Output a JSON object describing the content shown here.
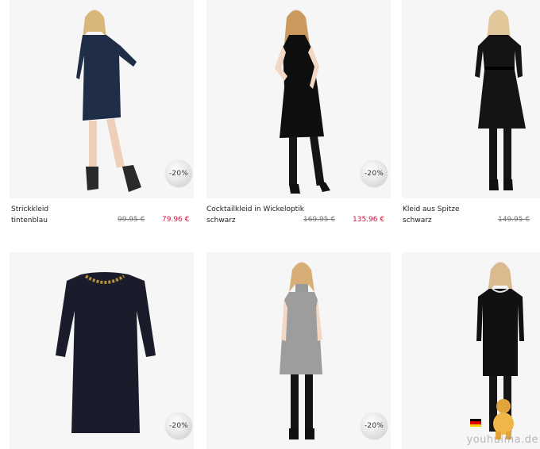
{
  "products": [
    {
      "name": "Strickkleid",
      "color": "tintenblau",
      "old_price": "99.95 €",
      "new_price": "79.96 €",
      "discount": "-20%"
    },
    {
      "name": "Cocktailkleid in Wickeloptik",
      "color": "schwarz",
      "old_price": "169.95 €",
      "new_price": "135.96 €",
      "discount": "-20%"
    },
    {
      "name": "Kleid aus Spitze",
      "color": "schwarz",
      "old_price": "149.95 €",
      "new_price": "",
      "discount": ""
    },
    {
      "name": "",
      "color": "",
      "old_price": "",
      "new_price": "",
      "discount": "-20%"
    },
    {
      "name": "",
      "color": "",
      "old_price": "",
      "new_price": "",
      "discount": "-20%"
    },
    {
      "name": "",
      "color": "",
      "old_price": "",
      "new_price": "",
      "discount": ""
    }
  ],
  "watermark": {
    "text": "youhuima.de"
  },
  "colors": {
    "sale_price": "#d2143a",
    "text": "#222222",
    "old_price": "#777777"
  }
}
